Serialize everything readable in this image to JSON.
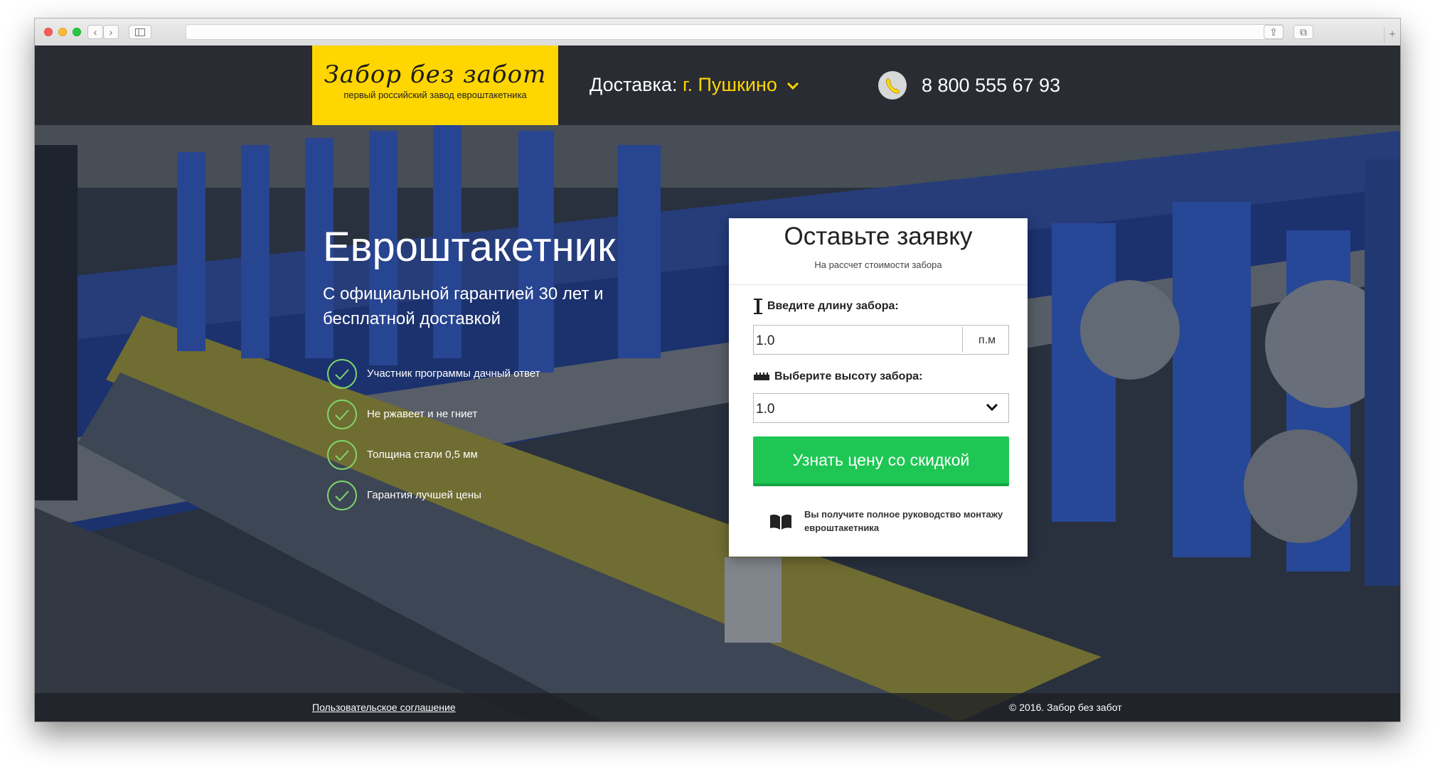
{
  "browser": {
    "back_glyph": "‹",
    "forward_glyph": "›",
    "sidebar_icon": "sidebar-icon",
    "reload_glyph": "↻",
    "share_glyph": "⇪",
    "tabs_glyph": "⧉",
    "new_tab_glyph": "+"
  },
  "header": {
    "logo_title": "Забор без забот",
    "logo_subtitle": "первый российский завод евроштакетника",
    "delivery_label": "Доставка:",
    "delivery_city": "г. Пушкино",
    "phone": "8 800 555 67 93"
  },
  "hero": {
    "title": "Евроштакетник",
    "subtitle": "С официальной гарантией 30 лет и бесплатной доставкой",
    "features": [
      "Участник программы дачный ответ",
      "Не ржавеет и не гниет",
      "Толщина стали 0,5 мм",
      "Гарантия лучшей цены"
    ]
  },
  "form": {
    "title": "Оставьте заявку",
    "note": "На рассчет стоимости забора",
    "length_label": "Введите длину забора:",
    "length_value": "1.0",
    "length_unit": "п.м",
    "height_label": "Выберите высоту забора:",
    "height_value": "1.0",
    "submit_label": "Узнать цену со скидкой",
    "guide_text": "Вы получите полное руководство монтажу евроштакетника"
  },
  "footer": {
    "agreement": "Пользовательское соглашение",
    "copyright": "© 2016. Забор без забот"
  },
  "colors": {
    "brand_yellow": "#ffd600",
    "cta_green": "#1ec653",
    "check_green": "#7fd66a"
  }
}
